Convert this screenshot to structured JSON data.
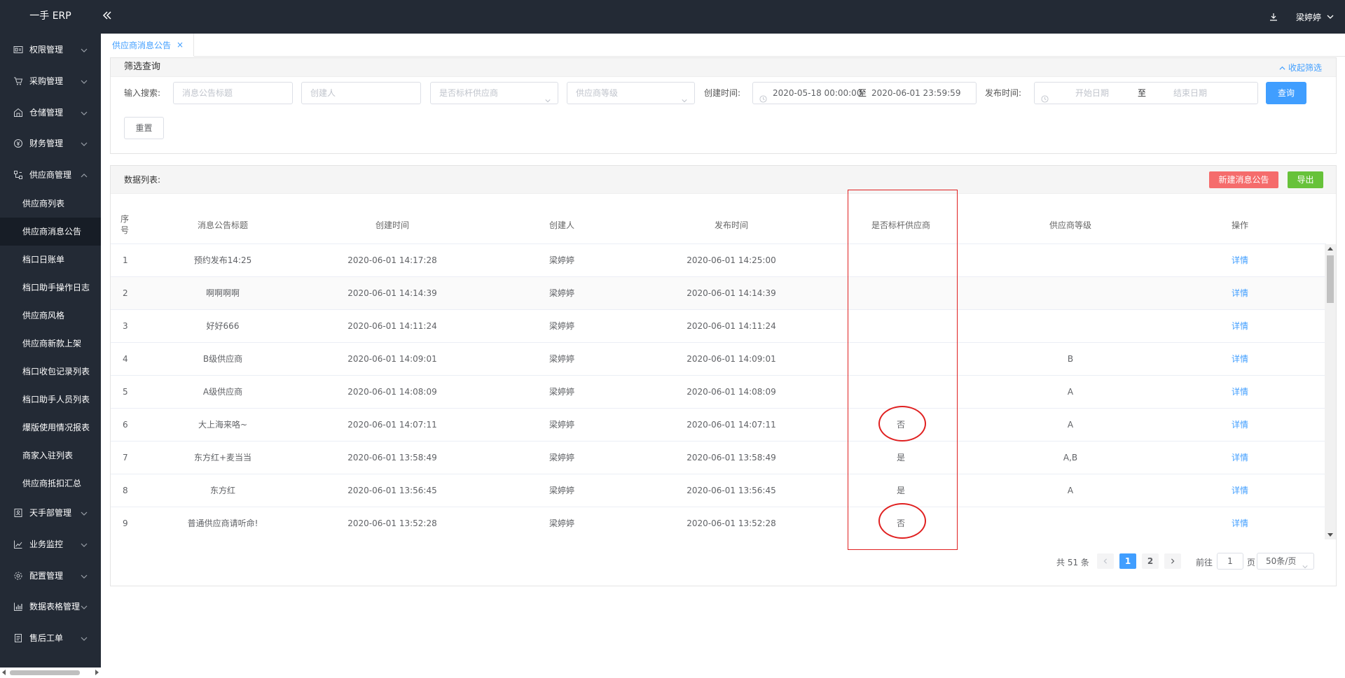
{
  "app": {
    "logo": "一手 ERP",
    "user_name": "梁婷婷"
  },
  "sidebar": {
    "groups": [
      {
        "label": "权限管理",
        "icon": "id-card-icon",
        "expanded": false
      },
      {
        "label": "采购管理",
        "icon": "cart-icon",
        "expanded": false
      },
      {
        "label": "仓储管理",
        "icon": "warehouse-icon",
        "expanded": false
      },
      {
        "label": "财务管理",
        "icon": "money-icon",
        "expanded": false
      },
      {
        "label": "供应商管理",
        "icon": "supplier-icon",
        "expanded": true
      },
      {
        "label": "天手部管理",
        "icon": "user-book-icon",
        "expanded": false
      },
      {
        "label": "业务监控",
        "icon": "monitor-chart-icon",
        "expanded": false
      },
      {
        "label": "配置管理",
        "icon": "gear-icon",
        "expanded": false
      },
      {
        "label": "数据表格管理",
        "icon": "bar-chart-icon",
        "expanded": false
      },
      {
        "label": "售后工单",
        "icon": "document-icon",
        "expanded": false
      }
    ],
    "supplier_items": [
      "供应商列表",
      "供应商消息公告",
      "档口日账单",
      "档口助手操作日志",
      "供应商风格",
      "供应商新款上架",
      "档口收包记录列表",
      "档口助手人员列表",
      "爆版使用情况报表",
      "商家入驻列表",
      "供应商抵扣汇总"
    ],
    "active_item": "供应商消息公告"
  },
  "tabs": [
    {
      "label": "供应商消息公告",
      "active": true
    }
  ],
  "filter": {
    "title": "筛选查询",
    "collapse_label": "收起筛选",
    "search_label": "输入搜索:",
    "title_placeholder": "消息公告标题",
    "creator_placeholder": "创建人",
    "benchmark_placeholder": "是否标杆供应商",
    "level_placeholder": "供应商等级",
    "created_label": "创建时间:",
    "created_start": "2020-05-18 00:00:00",
    "range_sep": "至",
    "created_end": "2020-06-01 23:59:59",
    "publish_label": "发布时间:",
    "publish_start_placeholder": "开始日期",
    "publish_end_placeholder": "结束日期",
    "query_label": "查询",
    "reset_label": "重置"
  },
  "data_list": {
    "title": "数据列表:",
    "new_button": "新建消息公告",
    "export_button": "导出",
    "columns": {
      "index": "序\n号",
      "title": "消息公告标题",
      "created": "创建时间",
      "creator": "创建人",
      "published": "发布时间",
      "benchmark": "是否标杆供应商",
      "level": "供应商等级",
      "action": "操作"
    },
    "rows": [
      {
        "index": "1",
        "title": "预约发布14:25",
        "created": "2020-06-01 14:17:28",
        "creator": "梁婷婷",
        "published": "2020-06-01 14:25:00",
        "benchmark": "",
        "level": "",
        "action": "详情"
      },
      {
        "index": "2",
        "title": "啊啊啊啊",
        "created": "2020-06-01 14:14:39",
        "creator": "梁婷婷",
        "published": "2020-06-01 14:14:39",
        "benchmark": "",
        "level": "",
        "action": "详情"
      },
      {
        "index": "3",
        "title": "好好666",
        "created": "2020-06-01 14:11:24",
        "creator": "梁婷婷",
        "published": "2020-06-01 14:11:24",
        "benchmark": "",
        "level": "",
        "action": "详情"
      },
      {
        "index": "4",
        "title": "B级供应商",
        "created": "2020-06-01 14:09:01",
        "creator": "梁婷婷",
        "published": "2020-06-01 14:09:01",
        "benchmark": "",
        "level": "B",
        "action": "详情"
      },
      {
        "index": "5",
        "title": "A级供应商",
        "created": "2020-06-01 14:08:09",
        "creator": "梁婷婷",
        "published": "2020-06-01 14:08:09",
        "benchmark": "",
        "level": "A",
        "action": "详情"
      },
      {
        "index": "6",
        "title": "大上海来咯~",
        "created": "2020-06-01 14:07:11",
        "creator": "梁婷婷",
        "published": "2020-06-01 14:07:11",
        "benchmark": "否",
        "level": "A",
        "action": "详情"
      },
      {
        "index": "7",
        "title": "东方红+麦当当",
        "created": "2020-06-01 13:58:49",
        "creator": "梁婷婷",
        "published": "2020-06-01 13:58:49",
        "benchmark": "是",
        "level": "A,B",
        "action": "详情"
      },
      {
        "index": "8",
        "title": "东方红",
        "created": "2020-06-01 13:56:45",
        "creator": "梁婷婷",
        "published": "2020-06-01 13:56:45",
        "benchmark": "是",
        "level": "A",
        "action": "详情"
      },
      {
        "index": "9",
        "title": "普通供应商请听命!",
        "created": "2020-06-01 13:52:28",
        "creator": "梁婷婷",
        "published": "2020-06-01 13:52:28",
        "benchmark": "否",
        "level": "",
        "action": "详情"
      }
    ]
  },
  "pagination": {
    "total_text": "共 51 条",
    "pages": [
      "1",
      "2"
    ],
    "current_page": "1",
    "goto_label": "前往",
    "goto_value": "1",
    "page_unit": "页",
    "page_size": "50条/页"
  },
  "colors": {
    "sidebar_bg": "#232a35",
    "primary": "#409eff",
    "danger": "#f56c6c",
    "success": "#67c23a",
    "annotation": "#e02020"
  }
}
